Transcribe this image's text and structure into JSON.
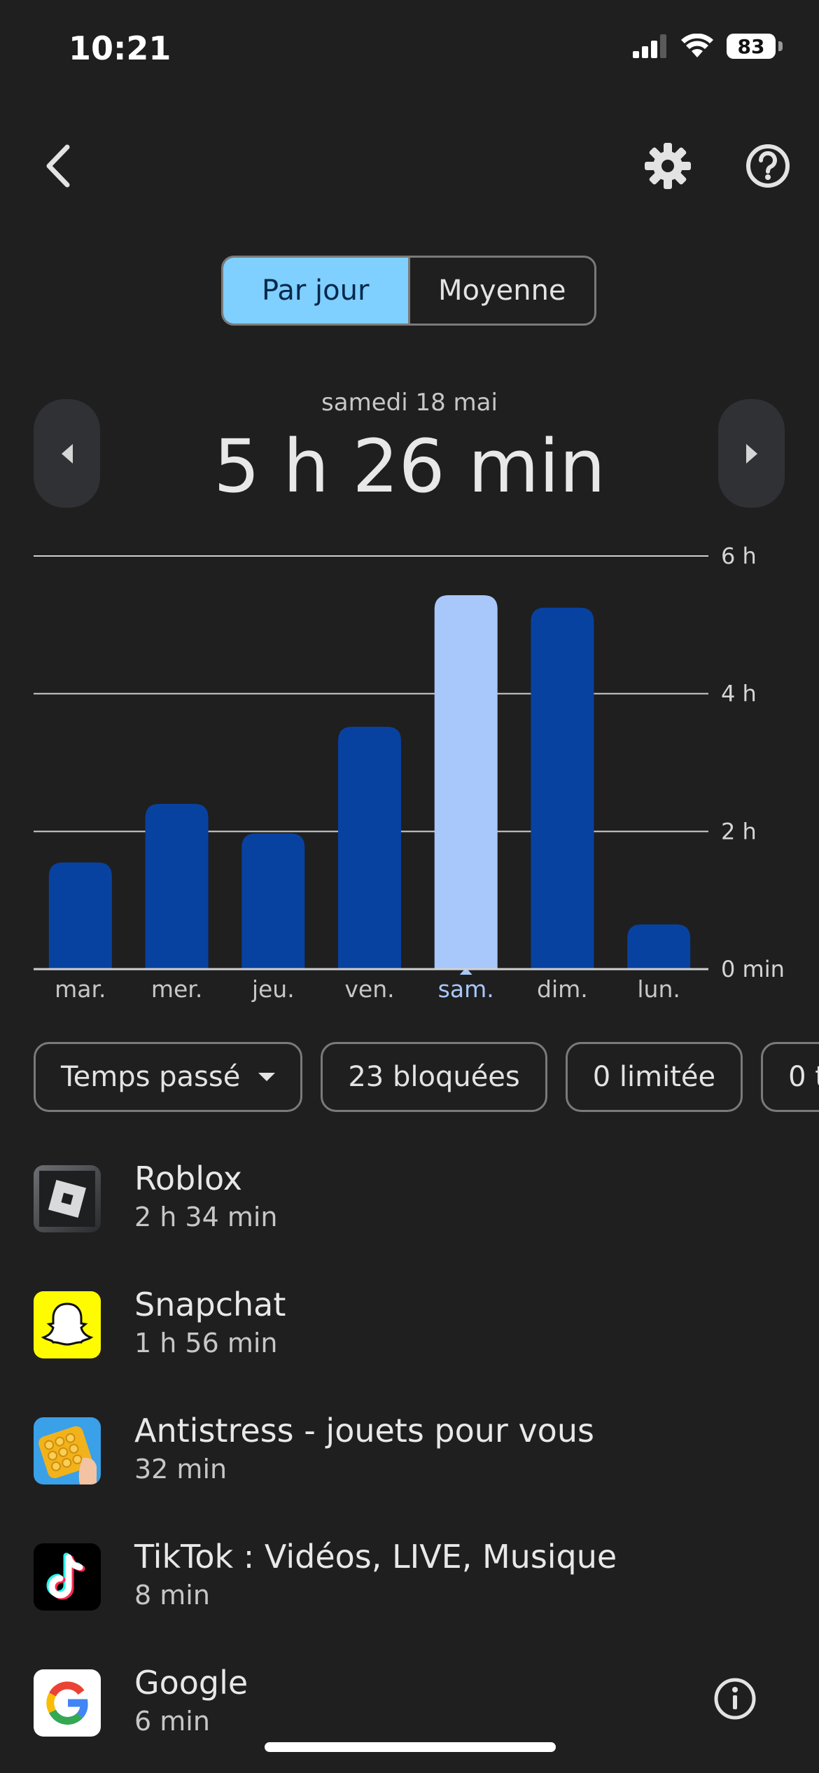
{
  "status_bar": {
    "time": "10:21",
    "battery": "83"
  },
  "tabs": [
    {
      "label": "Par jour",
      "active": true
    },
    {
      "label": "Moyenne",
      "active": false
    }
  ],
  "date_label": "samedi 18 mai",
  "total_time": "5 h 26 min",
  "chart_data": {
    "type": "bar",
    "categories": [
      "mar.",
      "mer.",
      "jeu.",
      "ven.",
      "sam.",
      "dim.",
      "lun."
    ],
    "values": [
      1.55,
      2.4,
      1.97,
      3.52,
      5.43,
      5.25,
      0.65
    ],
    "selected_index": 4,
    "y_ticks": [
      {
        "value": 0,
        "label": "0 min"
      },
      {
        "value": 2,
        "label": "2 h"
      },
      {
        "value": 4,
        "label": "4 h"
      },
      {
        "value": 6,
        "label": "6 h"
      }
    ],
    "ylim": [
      0,
      6
    ],
    "grid": true,
    "colors": {
      "bar": "#0842a0",
      "selected_bar": "#a8c7fa",
      "selected_label": "#a8c7fa"
    }
  },
  "filters": [
    {
      "label": "Temps passé",
      "dropdown": true
    },
    {
      "label": "23 bloquées"
    },
    {
      "label": "0 limitée"
    },
    {
      "label": "0 t"
    }
  ],
  "apps": [
    {
      "name": "Roblox",
      "time": "2 h 34 min",
      "icon": "roblox-icon"
    },
    {
      "name": "Snapchat",
      "time": "1 h 56 min",
      "icon": "snapchat-icon"
    },
    {
      "name": "Antistress - jouets pour vous",
      "time": "32 min",
      "icon": "antistress-icon"
    },
    {
      "name": "TikTok : Vidéos, LIVE, Musique",
      "time": "8 min",
      "icon": "tiktok-icon"
    },
    {
      "name": "Google",
      "time": "6 min",
      "icon": "google-icon"
    }
  ]
}
